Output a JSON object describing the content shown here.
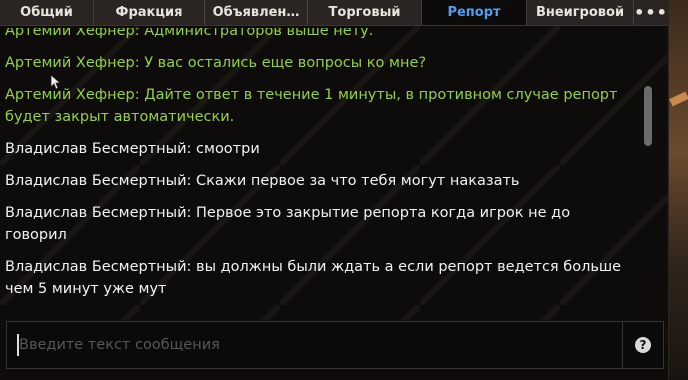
{
  "tabs": [
    {
      "label": "Общий",
      "active": false
    },
    {
      "label": "Фракция",
      "active": false
    },
    {
      "label": "Объявлен…",
      "active": false
    },
    {
      "label": "Торговый",
      "active": false
    },
    {
      "label": "Репорт",
      "active": true
    },
    {
      "label": "Внеигровой",
      "active": false
    },
    {
      "label": "•••",
      "active": false
    }
  ],
  "messages": [
    {
      "author_type": "admin",
      "text": "Артемий Хефнер: Администраторов выше нету."
    },
    {
      "author_type": "admin",
      "text": "Артемий Хефнер: У вас остались еще вопросы ко мне?"
    },
    {
      "author_type": "admin",
      "text": "Артемий Хефнер: Дайте ответ в течение 1 минуты, в противном случае репорт будет закрыт автоматически."
    },
    {
      "author_type": "player",
      "text": "Владислав Бесмертный: смоотри"
    },
    {
      "author_type": "player",
      "text": "Владислав Бесмертный: Скажи первое за что тебя могут наказать"
    },
    {
      "author_type": "player",
      "text": "Владислав Бесмертный: Первое это закрытие репорта когда игрок не до говорил"
    },
    {
      "author_type": "player",
      "text": "Владислав Бесмертный: вы должны были ждать а если репорт ведется больше чем 5 минут уже мут"
    }
  ],
  "input": {
    "placeholder": "Введите текст сообщения",
    "value": ""
  },
  "help_button": {
    "icon": "question-circle-icon",
    "glyph": "?"
  },
  "colors": {
    "admin_text": "#95d040",
    "player_text": "#f2f2f2",
    "active_tab": "#4f9ef0"
  }
}
